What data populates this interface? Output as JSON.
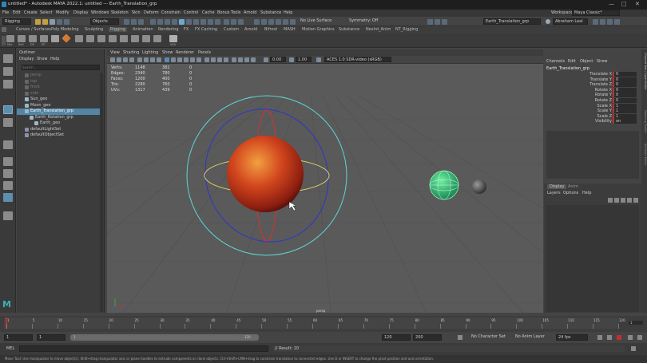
{
  "titlebar": {
    "title": "untitled* - Autodesk MAYA 2022.1: untitled    ---    Earth_Translation_grp"
  },
  "menubar": {
    "items": [
      "File",
      "Edit",
      "Create",
      "Select",
      "Modify",
      "Display",
      "Windows",
      "Skeleton",
      "Skin",
      "Deform",
      "Constrain",
      "Control",
      "Cache",
      "Bonus Tools",
      "Arnold",
      "Substance",
      "Help"
    ],
    "workspace_label": "Workspace:",
    "workspace_value": "Maya Classic*"
  },
  "statusline": {
    "menuset": "Rigging",
    "select_mode": "Objects",
    "live_surface": "No Live Surface",
    "symmetry": "Symmetry: Off",
    "name_field": "Earth_Translation_grp",
    "user": "Abraham Leal"
  },
  "shelf": {
    "tabs": [
      "Curves / Surfaces",
      "Poly Modeling",
      "Sculpting",
      "Rigging",
      "Animation",
      "Rendering",
      "FX",
      "FX Caching",
      "Custom",
      "Arnold",
      "Bifrost",
      "MASH",
      "Motion Graphics",
      "Substance",
      "Nexhd_Anim",
      "NT_Rigging"
    ],
    "active_tab": "Rigging",
    "icon_labels": [
      "Mirr",
      "Refl",
      "DP",
      "PP",
      "VKA"
    ]
  },
  "outliner": {
    "title": "Outliner",
    "menus": [
      "Display",
      "Show",
      "Help"
    ],
    "search_placeholder": "Search...",
    "items": [
      {
        "name": "persp",
        "faded": true,
        "indent": 0
      },
      {
        "name": "top",
        "faded": true,
        "indent": 0
      },
      {
        "name": "front",
        "faded": true,
        "indent": 0
      },
      {
        "name": "side",
        "faded": true,
        "indent": 0
      },
      {
        "name": "Sun_geo",
        "faded": false,
        "indent": 0
      },
      {
        "name": "Moon_geo",
        "faded": false,
        "indent": 0
      },
      {
        "name": "Earth_Translation_grp",
        "faded": false,
        "indent": 0,
        "selected": true
      },
      {
        "name": "Earth_Rotation_grp",
        "faded": false,
        "indent": 1
      },
      {
        "name": "Earth_geo",
        "faded": false,
        "indent": 2
      },
      {
        "name": "defaultLightSet",
        "faded": false,
        "indent": 0
      },
      {
        "name": "defaultObjectSet",
        "faded": false,
        "indent": 0
      }
    ]
  },
  "viewport": {
    "menus": [
      "View",
      "Shading",
      "Lighting",
      "Show",
      "Renderer",
      "Panels"
    ],
    "exposure": "0.00",
    "gamma": "1.00",
    "colorspace": "ACES 1.0 SDR-video (sRGB)",
    "camera_label": "persp",
    "hud": [
      {
        "label": "Verts:",
        "a": "1148",
        "b": "382",
        "c": "0"
      },
      {
        "label": "Edges:",
        "a": "2340",
        "b": "780",
        "c": "0"
      },
      {
        "label": "Faces:",
        "a": "1200",
        "b": "400",
        "c": "0"
      },
      {
        "label": "Tris:",
        "a": "2280",
        "b": "760",
        "c": "0"
      },
      {
        "label": "UVs:",
        "a": "1317",
        "b": "439",
        "c": "0"
      }
    ]
  },
  "channelbox": {
    "menus": [
      "Channels",
      "Edit",
      "Object",
      "Show"
    ],
    "object": "Earth_Translation_grp",
    "attrs": [
      {
        "name": "Translate X",
        "value": "0"
      },
      {
        "name": "Translate Y",
        "value": "0"
      },
      {
        "name": "Translate Z",
        "value": "0"
      },
      {
        "name": "Rotate X",
        "value": "0"
      },
      {
        "name": "Rotate Y",
        "value": "0"
      },
      {
        "name": "Rotate Z",
        "value": "0"
      },
      {
        "name": "Scale X",
        "value": "1"
      },
      {
        "name": "Scale Y",
        "value": "1"
      },
      {
        "name": "Scale Z",
        "value": "1"
      },
      {
        "name": "Visibility",
        "value": "on"
      }
    ]
  },
  "layers": {
    "tabs": [
      "Display",
      "Anim"
    ],
    "menus": [
      "Layers",
      "Options",
      "Help"
    ]
  },
  "sidetabs": [
    "Channel Box / Layer Editor",
    "Modeling Toolkit",
    "Attribute Editor"
  ],
  "timeslider": {
    "ticks": [
      "1",
      "5",
      "10",
      "15",
      "20",
      "25",
      "30",
      "35",
      "40",
      "45",
      "50",
      "55",
      "60",
      "65",
      "70",
      "75",
      "80",
      "85",
      "90",
      "95",
      "100",
      "105",
      "110",
      "115",
      "120"
    ],
    "current": "1"
  },
  "range": {
    "start": "1",
    "inner_start": "1",
    "range_handle": "1",
    "range_end_handle": "120",
    "inner_end": "120",
    "end": "200",
    "character_set": "No Character Set",
    "anim_layer": "No Anim Layer",
    "fps": "24 fps"
  },
  "cmd": {
    "lang": "MEL",
    "result": "// Result: 10"
  },
  "help": {
    "text": "Move Tool: Use manipulator to move object(s). Shift+drag manipulator axis or plane handles to extrude components or clone objects. Ctrl+Shift+LMB+drag to constrain translation to connected edges. Use D or INSERT to change the pivot position and axis orientation."
  },
  "colors": {
    "selection": "#5285a6",
    "keyed_red": "#c03030",
    "manip_cyan": "#5fd6d6",
    "manip_blue": "#2c36c8",
    "manip_red": "#d83030",
    "manip_yellow": "#e0d060",
    "sun_orange": "#d2461e",
    "earth_green": "#2cc070"
  }
}
